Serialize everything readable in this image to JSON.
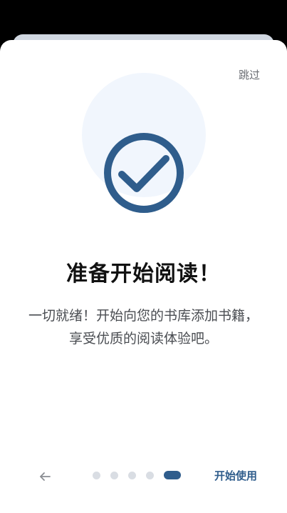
{
  "header": {
    "skip_label": "跳过"
  },
  "hero": {
    "icon": "check-circle-icon",
    "accent_color": "#2f5d8c"
  },
  "content": {
    "title": "准备开始阅读！",
    "description": "一切就绪！开始向您的书库添加书籍，享受优质的阅读体验吧。"
  },
  "navigation": {
    "prev_icon": "arrow-left-icon",
    "pages_total": 5,
    "current_page": 5,
    "start_label": "开始使用"
  }
}
